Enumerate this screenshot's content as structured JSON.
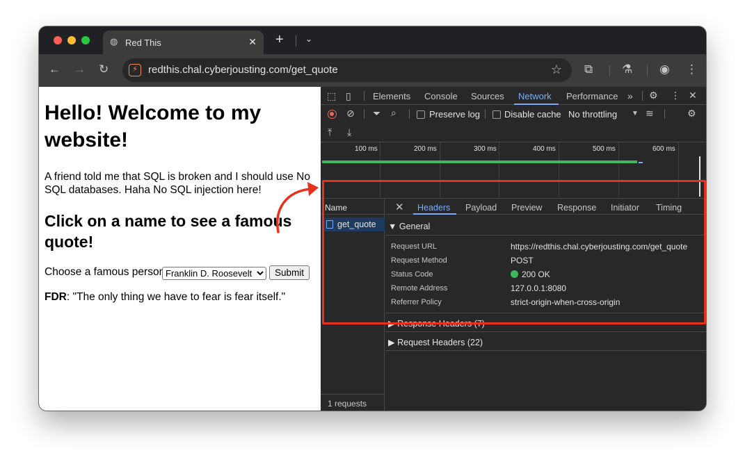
{
  "browser": {
    "tab_title": "Red This",
    "new_tab": "+",
    "url": "redthis.chal.cyberjousting.com/get_quote"
  },
  "page": {
    "heading": "Hello! Welcome to my website!",
    "intro": "A friend told me that SQL is broken and I should use No SQL databases. Haha No SQL injection here!",
    "subheading": "Click on a name to see a famous quote!",
    "chooser_label": "Choose a famous person",
    "selected_person": "Franklin D. Roosevelt",
    "submit_label": "Submit",
    "quote_author": "FDR",
    "quote_text": ": \"The only thing we have to fear is fear itself.\""
  },
  "devtools": {
    "tabs": [
      "Elements",
      "Console",
      "Sources",
      "Network",
      "Performance"
    ],
    "active_tab": "Network",
    "controls": {
      "preserve_log": "Preserve log",
      "disable_cache": "Disable cache",
      "throttling": "No throttling"
    },
    "timeline_labels": [
      "100 ms",
      "200 ms",
      "300 ms",
      "400 ms",
      "500 ms",
      "600 ms"
    ],
    "name_header": "Name",
    "request_name": "get_quote",
    "requests_count": "1 requests",
    "detail_tabs": [
      "Headers",
      "Payload",
      "Preview",
      "Response",
      "Initiator",
      "Timing"
    ],
    "general": {
      "title": "▼ General",
      "rows": [
        {
          "key": "Request URL",
          "value": "https://redthis.chal.cyberjousting.com/get_quote"
        },
        {
          "key": "Request Method",
          "value": "POST"
        },
        {
          "key": "Status Code",
          "value": "200 OK"
        },
        {
          "key": "Remote Address",
          "value": "127.0.0.1:8080"
        },
        {
          "key": "Referrer Policy",
          "value": "strict-origin-when-cross-origin"
        }
      ]
    },
    "response_headers": "▶ Response Headers (7)",
    "request_headers": "▶ Request Headers (22)"
  },
  "colors": {
    "accent": "#7cacf8",
    "highlight": "#e8311c",
    "status_ok": "#3fb85f"
  }
}
